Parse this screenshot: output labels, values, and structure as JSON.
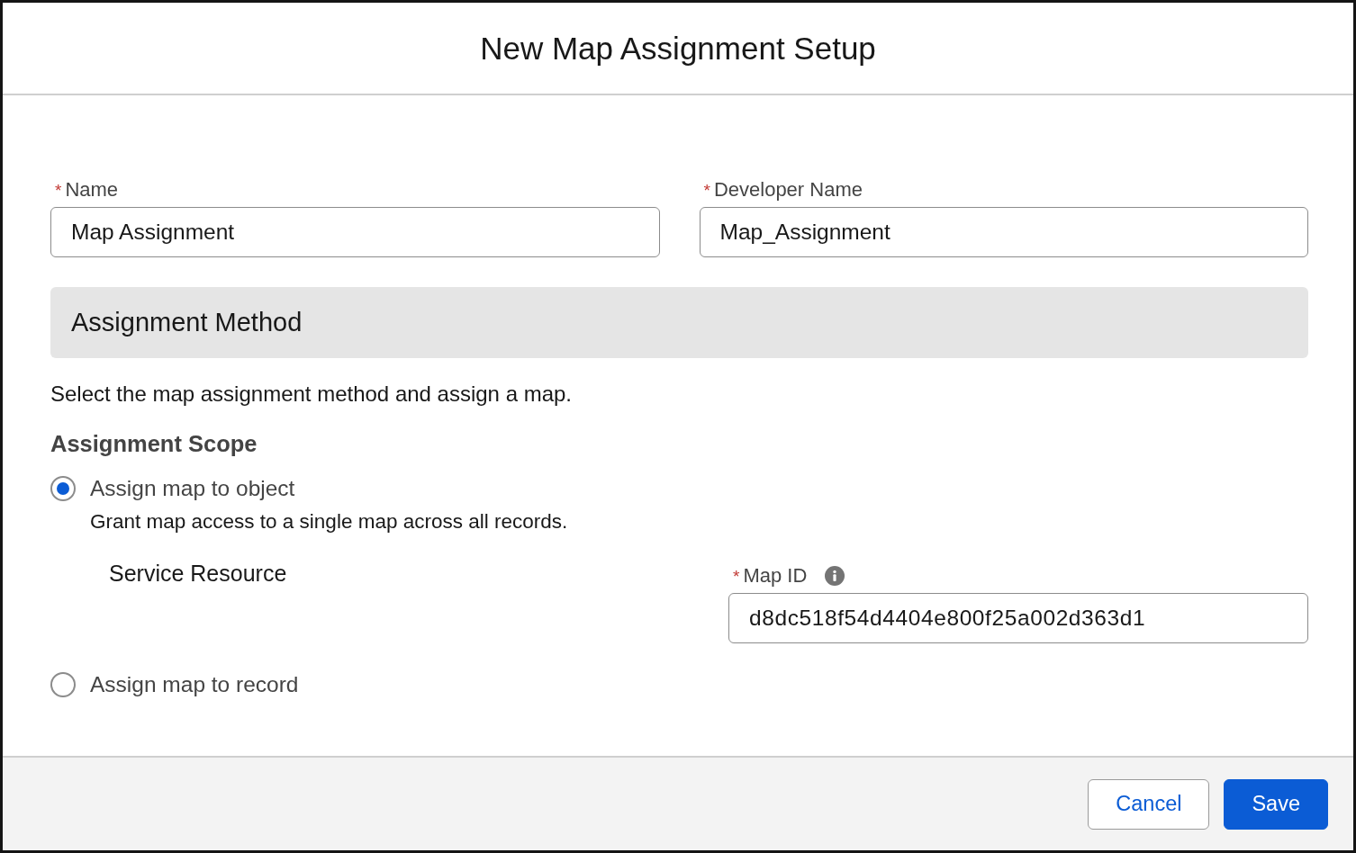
{
  "modal": {
    "title": "New Map Assignment Setup"
  },
  "fields": [
    {
      "required_mark": "*",
      "label": "Name",
      "value": "Map Assignment"
    },
    {
      "required_mark": "*",
      "label": "Developer Name",
      "value": "Map_Assignment"
    }
  ],
  "assignment_method": {
    "heading": "Assignment Method",
    "description": "Select the map assignment method and assign a map."
  },
  "assignment_scope": {
    "heading": "Assignment Scope",
    "options": [
      {
        "label": "Assign map to object",
        "selected": true,
        "help": "Grant map access to a single map across all records.",
        "object": "Service Resource",
        "map_id": {
          "required_mark": "*",
          "label": "Map ID",
          "value": "d8dc518f54d4404e800f25a002d363d1"
        }
      },
      {
        "label": "Assign map to record",
        "selected": false
      }
    ]
  },
  "buttons": [
    {
      "label": "Cancel",
      "kind": "neutral"
    },
    {
      "label": "Save",
      "kind": "brand"
    }
  ]
}
